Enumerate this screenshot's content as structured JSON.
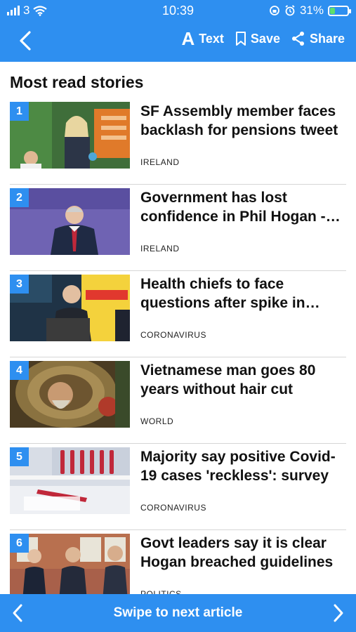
{
  "status_bar": {
    "carrier": "3",
    "time": "10:39",
    "battery_percent": "31%",
    "battery_level": 0.31
  },
  "nav": {
    "text_label": "Text",
    "save_label": "Save",
    "share_label": "Share"
  },
  "section_title": "Most read stories",
  "stories": [
    {
      "rank": "1",
      "headline": "SF Assembly member faces backlash for pensions tweet",
      "category": "IRELAND"
    },
    {
      "rank": "2",
      "headline": "Government has lost confidence in Phil Hogan - R...",
      "category": "IRELAND"
    },
    {
      "rank": "3",
      "headline": "Health chiefs to face questions after spike in cases",
      "category": "CORONAVIRUS"
    },
    {
      "rank": "4",
      "headline": "Vietnamese man goes 80 years without hair cut",
      "category": "WORLD"
    },
    {
      "rank": "5",
      "headline": "Majority say positive Covid-19 cases 'reckless': survey",
      "category": "CORONAVIRUS"
    },
    {
      "rank": "6",
      "headline": "Govt leaders say it is clear Hogan breached guidelines",
      "category": "POLITICS"
    }
  ],
  "bottom_bar": {
    "swipe_label": "Swipe to next article"
  },
  "colors": {
    "accent": "#2e8ff0"
  }
}
